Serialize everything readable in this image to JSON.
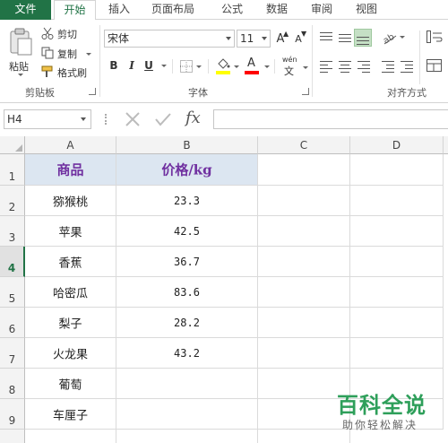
{
  "ribbon_tabs": [
    "文件",
    "开始",
    "插入",
    "页面布局",
    "公式",
    "数据",
    "审阅",
    "视图"
  ],
  "clipboard": {
    "paste_label": "粘贴",
    "cut_label": "剪切",
    "copy_label": "复制",
    "format_painter_label": "格式刷",
    "group_label": "剪贴板"
  },
  "font": {
    "name": "宋体",
    "size": "11",
    "bold": "B",
    "italic": "I",
    "underline": "U",
    "grow": "A",
    "shrink": "A",
    "font_color_letter": "A",
    "highlight_color": "#ffff00",
    "font_color": "#ff0000",
    "phonetic_label": "wén",
    "group_label": "字体"
  },
  "alignment": {
    "group_label": "对齐方式"
  },
  "formula_bar": {
    "name_box": "H4",
    "fx": "fx",
    "formula": ""
  },
  "columns": [
    "A",
    "B",
    "C",
    "D"
  ],
  "rows": [
    "1",
    "2",
    "3",
    "4",
    "5",
    "6",
    "7",
    "8",
    "9"
  ],
  "active_row": "4",
  "table": {
    "header": [
      "商品",
      "价格/kg"
    ],
    "rows": [
      [
        "猕猴桃",
        "23.3"
      ],
      [
        "苹果",
        "42.5"
      ],
      [
        "香蕉",
        "36.7"
      ],
      [
        "哈密瓜",
        "83.6"
      ],
      [
        "梨子",
        "28.2"
      ],
      [
        "火龙果",
        "43.2"
      ],
      [
        "葡萄",
        ""
      ],
      [
        "车厘子",
        ""
      ]
    ]
  },
  "watermark": {
    "title": "百科全说",
    "subtitle": "助你轻松解决"
  },
  "colors": {
    "excel_green": "#217346",
    "header_fill": "#dce6f1",
    "header_text": "#7030a0"
  }
}
